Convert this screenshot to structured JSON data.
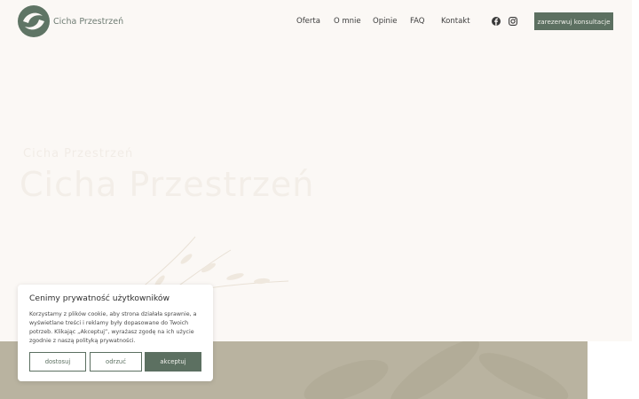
{
  "header": {
    "logo_text": "Cicha Przestrzeń",
    "nav": [
      {
        "label": "Oferta"
      },
      {
        "label": "O mnie"
      },
      {
        "label": "Opinie"
      },
      {
        "label": "FAQ"
      },
      {
        "label": "Kontakt"
      }
    ],
    "social": [
      "facebook-icon",
      "instagram-icon"
    ],
    "cta_label": "zarezerwuj konsultacje"
  },
  "hero": {
    "subtitle": "Cicha Przestrzeń",
    "title": "Cicha Przestrzeń"
  },
  "cookie": {
    "title": "Cenimy prywatność użytkowników",
    "text": "Korzystamy z plików cookie, aby strona działała sprawnie, a wyświetlane treści i reklamy były dopasowane do Twoich potrzeb. Klikając „Akceptuj”, wyrażasz zgodę na ich użycie zgodnie z naszą polityką prywatności.",
    "buttons": {
      "customize": "dostosuj",
      "reject": "odrzuć",
      "accept": "akceptuj"
    }
  },
  "colors": {
    "accent": "#5c7061",
    "hero_bg": "#fbf8f5",
    "band": "#b9b3a0"
  }
}
